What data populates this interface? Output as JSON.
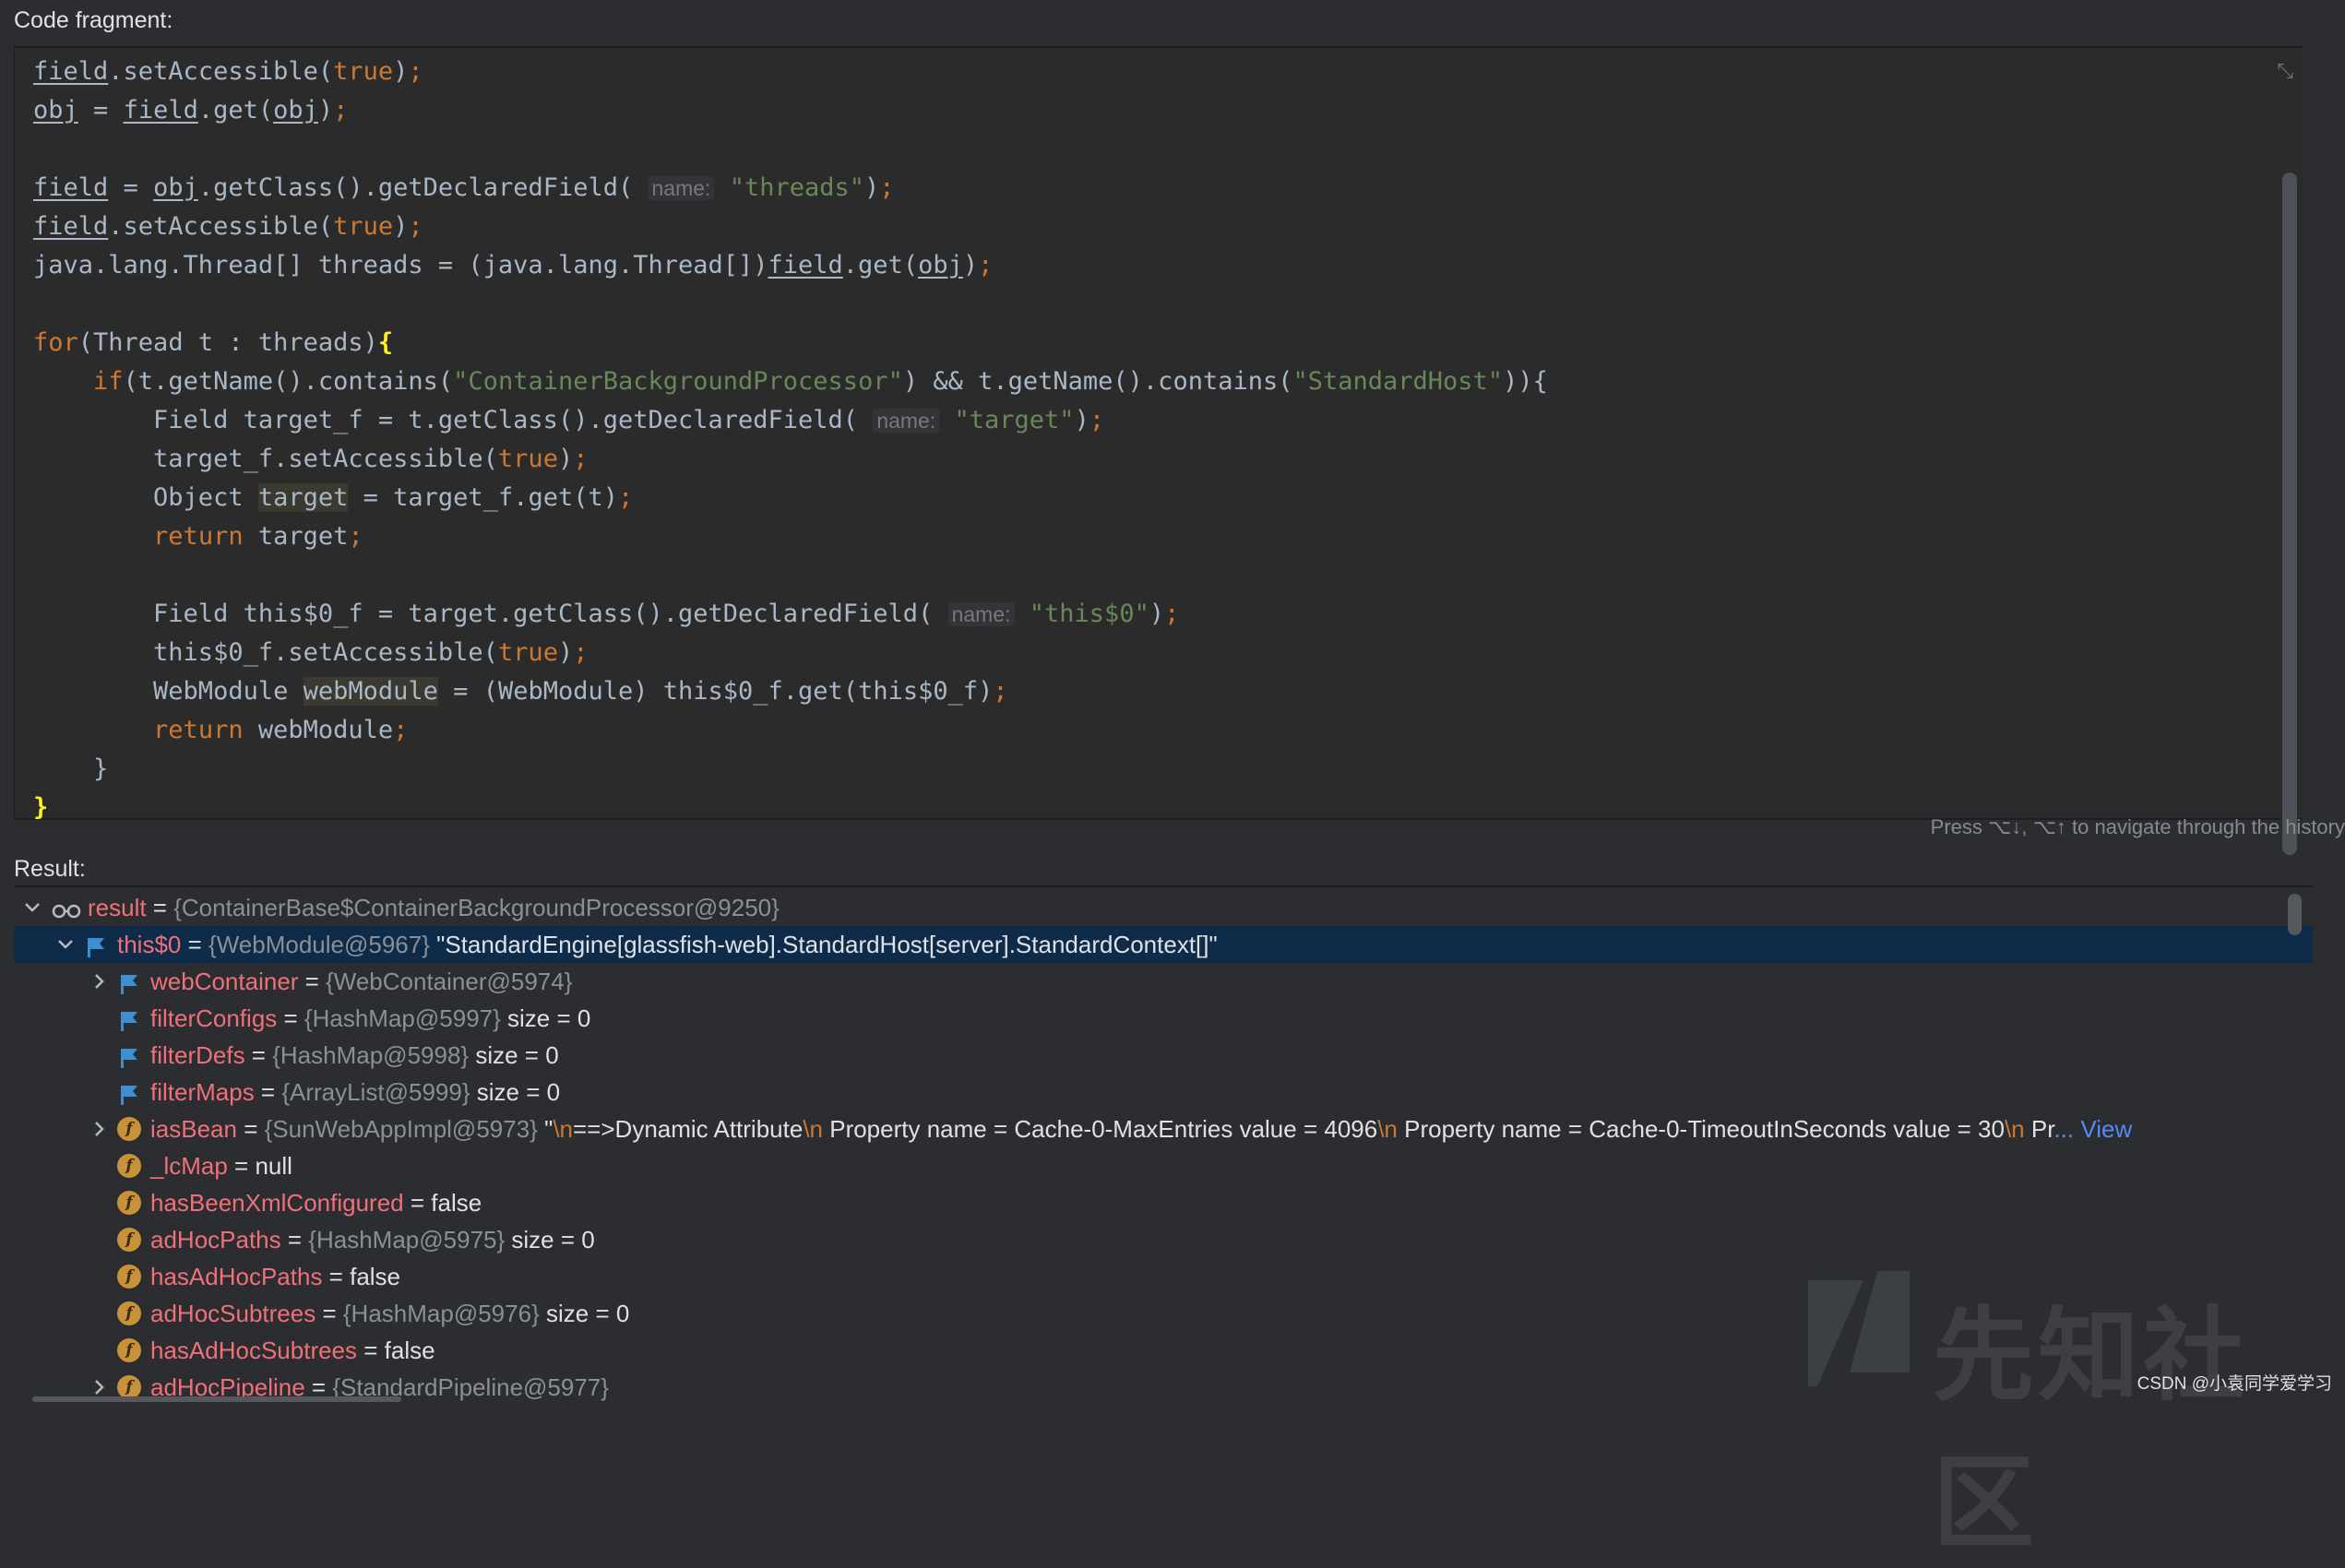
{
  "code_label": "Code fragment:",
  "code_lines": [
    [
      [
        "ul",
        "field"
      ],
      [
        "t",
        ".setAccessible("
      ],
      [
        "kw",
        "true"
      ],
      [
        "t",
        ")"
      ],
      [
        "kw",
        ";"
      ]
    ],
    [
      [
        "ul",
        "obj"
      ],
      [
        "t",
        " = "
      ],
      [
        "ul",
        "field"
      ],
      [
        "t",
        ".get("
      ],
      [
        "ul",
        "obj"
      ],
      [
        "t",
        ")"
      ],
      [
        "kw",
        ";"
      ]
    ],
    [],
    [
      [
        "ul",
        "field"
      ],
      [
        "t",
        " = "
      ],
      [
        "ul",
        "obj"
      ],
      [
        "t",
        ".getClass().getDeclaredField( "
      ],
      [
        "hint",
        "name:"
      ],
      [
        "t",
        " "
      ],
      [
        "str",
        "\"threads\""
      ],
      [
        "t",
        ")"
      ],
      [
        "kw",
        ";"
      ]
    ],
    [
      [
        "ul",
        "field"
      ],
      [
        "t",
        ".setAccessible("
      ],
      [
        "kw",
        "true"
      ],
      [
        "t",
        ")"
      ],
      [
        "kw",
        ";"
      ]
    ],
    [
      [
        "t",
        "java.lang.Thread[] threads = (java.lang.Thread[])"
      ],
      [
        "ul",
        "field"
      ],
      [
        "t",
        ".get("
      ],
      [
        "ul",
        "obj"
      ],
      [
        "t",
        ")"
      ],
      [
        "kw",
        ";"
      ]
    ],
    [],
    [
      [
        "kw",
        "for"
      ],
      [
        "t",
        "(Thread t : threads)"
      ],
      [
        "brace",
        "{"
      ]
    ],
    [
      [
        "t",
        "    "
      ],
      [
        "kw",
        "if"
      ],
      [
        "t",
        "(t.getName().contains("
      ],
      [
        "str",
        "\"ContainerBackgroundProcessor\""
      ],
      [
        "t",
        ") && t.getName().contains("
      ],
      [
        "str",
        "\"StandardHost\""
      ],
      [
        "t",
        "))"
      ],
      [
        "t",
        "{"
      ]
    ],
    [
      [
        "t",
        "        Field target_f = t.getClass().getDeclaredField( "
      ],
      [
        "hint",
        "name:"
      ],
      [
        "t",
        " "
      ],
      [
        "str",
        "\"target\""
      ],
      [
        "t",
        ")"
      ],
      [
        "kw",
        ";"
      ]
    ],
    [
      [
        "t",
        "        target_f.setAccessible("
      ],
      [
        "kw",
        "true"
      ],
      [
        "t",
        ")"
      ],
      [
        "kw",
        ";"
      ]
    ],
    [
      [
        "t",
        "        Object "
      ],
      [
        "hl",
        "target"
      ],
      [
        "t",
        " = target_f.get(t)"
      ],
      [
        "kw",
        ";"
      ]
    ],
    [
      [
        "t",
        "        "
      ],
      [
        "kw",
        "return"
      ],
      [
        "t",
        " target"
      ],
      [
        "kw",
        ";"
      ]
    ],
    [],
    [
      [
        "t",
        "        Field this$0_f = target.getClass().getDeclaredField( "
      ],
      [
        "hint",
        "name:"
      ],
      [
        "t",
        " "
      ],
      [
        "str",
        "\"this$0\""
      ],
      [
        "t",
        ")"
      ],
      [
        "kw",
        ";"
      ]
    ],
    [
      [
        "t",
        "        this$0_f.setAccessible("
      ],
      [
        "kw",
        "true"
      ],
      [
        "t",
        ")"
      ],
      [
        "kw",
        ";"
      ]
    ],
    [
      [
        "t",
        "        WebModule "
      ],
      [
        "hl",
        "webModule"
      ],
      [
        "t",
        " = (WebModule) this$0_f.get(this$0_f)"
      ],
      [
        "kw",
        ";"
      ]
    ],
    [
      [
        "t",
        "        "
      ],
      [
        "kw",
        "return"
      ],
      [
        "t",
        " webModule"
      ],
      [
        "kw",
        ";"
      ]
    ],
    [
      [
        "t",
        "    }"
      ]
    ],
    [
      [
        "brace",
        "}"
      ]
    ]
  ],
  "nav_hint": "Press ⌥↓, ⌥↑ to navigate through the history",
  "result_label": "Result:",
  "tree": [
    {
      "level": 0,
      "chev": "v",
      "icon": "watch",
      "name": "result",
      "ref": "{ContainerBase$ContainerBackgroundProcessor@9250}",
      "val": ""
    },
    {
      "level": 1,
      "chev": "v",
      "icon": "flag",
      "name": "this$0",
      "ref": "{WebModule@5967}",
      "val": "\"StandardEngine[glassfish-web].StandardHost[server].StandardContext[]\"",
      "selected": true
    },
    {
      "level": 2,
      "chev": ">",
      "icon": "flag",
      "name": "webContainer",
      "ref": "{WebContainer@5974}",
      "val": ""
    },
    {
      "level": 2,
      "chev": "",
      "icon": "flag",
      "name": "filterConfigs",
      "ref": "{HashMap@5997}",
      "val": "size = 0"
    },
    {
      "level": 2,
      "chev": "",
      "icon": "flag",
      "name": "filterDefs",
      "ref": "{HashMap@5998}",
      "val": "size = 0"
    },
    {
      "level": 2,
      "chev": "",
      "icon": "flag",
      "name": "filterMaps",
      "ref": "{ArrayList@5999}",
      "val": "size = 0"
    },
    {
      "level": 2,
      "chev": ">",
      "icon": "field",
      "name": "iasBean",
      "ref": "{SunWebAppImpl@5973}",
      "val": "\"",
      "segments": [
        [
          "esc",
          "\\n"
        ],
        [
          "val",
          "==>Dynamic Attribute"
        ],
        [
          "esc",
          "\\n"
        ],
        [
          "val",
          "  Property name = Cache-0-MaxEntries value = 4096"
        ],
        [
          "esc",
          "\\n"
        ],
        [
          "val",
          "  Property name = Cache-0-TimeoutInSeconds value = 30"
        ],
        [
          "esc",
          "\\n"
        ],
        [
          "val",
          "  Pr"
        ],
        [
          "link",
          "... View"
        ]
      ]
    },
    {
      "level": 2,
      "chev": "",
      "icon": "field",
      "name": "_lcMap",
      "ref": "",
      "val": "null"
    },
    {
      "level": 2,
      "chev": "",
      "icon": "field",
      "name": "hasBeenXmlConfigured",
      "ref": "",
      "val": "false"
    },
    {
      "level": 2,
      "chev": "",
      "icon": "field",
      "name": "adHocPaths",
      "ref": "{HashMap@5975}",
      "val": "size = 0"
    },
    {
      "level": 2,
      "chev": "",
      "icon": "field",
      "name": "hasAdHocPaths",
      "ref": "",
      "val": "false"
    },
    {
      "level": 2,
      "chev": "",
      "icon": "field",
      "name": "adHocSubtrees",
      "ref": "{HashMap@5976}",
      "val": "size = 0"
    },
    {
      "level": 2,
      "chev": "",
      "icon": "field",
      "name": "hasAdHocSubtrees",
      "ref": "",
      "val": "false"
    },
    {
      "level": 2,
      "chev": ">",
      "icon": "field",
      "name": "adHocPipeline",
      "ref": "{StandardPipeline@5977}",
      "val": ""
    }
  ],
  "watermark": "先知社区",
  "csdn": "CSDN @小袁同学爱学习",
  "colors": {
    "selected_row": "#0e2c4a",
    "field_name": "#f0707a",
    "keyword": "#cc7832",
    "string": "#6a8759"
  }
}
